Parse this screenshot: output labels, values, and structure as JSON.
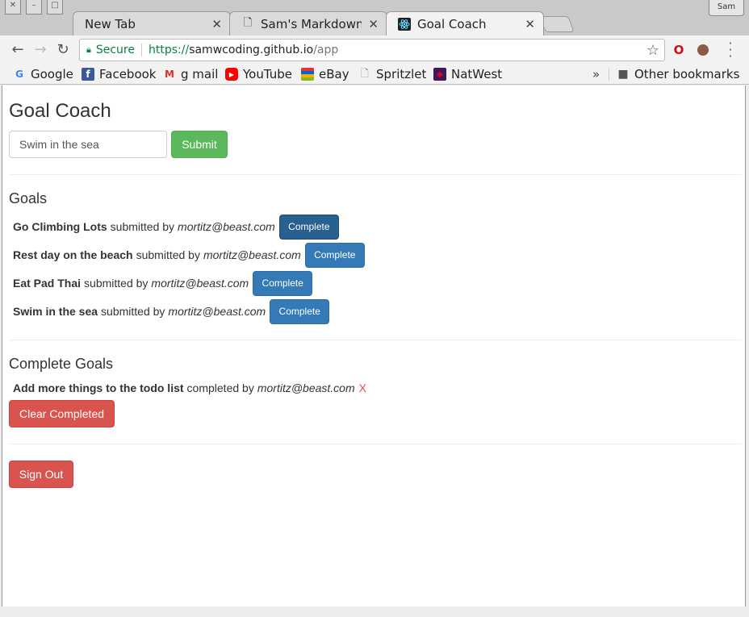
{
  "browser": {
    "profile_label": "Sam",
    "tabs": [
      {
        "title": "New Tab",
        "icon": "none",
        "active": false
      },
      {
        "title": "Sam's Markdown Pr",
        "icon": "page-icon",
        "active": false
      },
      {
        "title": "Goal Coach",
        "icon": "react-icon",
        "active": true
      }
    ],
    "tab_close": "✕",
    "omnibox": {
      "secure_label": "Secure",
      "url_scheme": "https://",
      "url_host": "samwcoding.github.io",
      "url_path": "/app"
    },
    "bookmarks": [
      {
        "label": "Google",
        "icon": "google-icon",
        "color": "#4285f4"
      },
      {
        "label": "Facebook",
        "icon": "facebook-icon",
        "color": "#3b5998"
      },
      {
        "label": "g mail",
        "icon": "gmail-icon",
        "color": "#d93025"
      },
      {
        "label": "YouTube",
        "icon": "youtube-icon",
        "color": "#ff0000"
      },
      {
        "label": "eBay",
        "icon": "ebay-icon",
        "color": "#e53238"
      },
      {
        "label": "Spritzlet",
        "icon": "page-icon",
        "color": "#777777"
      },
      {
        "label": "NatWest",
        "icon": "natwest-icon",
        "color": "#5a287d"
      }
    ],
    "bookmarks_overflow": "»",
    "other_bookmarks": "Other bookmarks"
  },
  "app": {
    "title": "Goal Coach",
    "input_value": "Swim in the sea",
    "submit_label": "Submit",
    "goals_heading": "Goals",
    "submitted_by": "submitted by",
    "complete_label": "Complete",
    "goals": [
      {
        "title": "Go Climbing Lots",
        "email": "mortitz@beast.com"
      },
      {
        "title": "Rest day on the beach",
        "email": "mortitz@beast.com"
      },
      {
        "title": "Eat Pad Thai",
        "email": "mortitz@beast.com"
      },
      {
        "title": "Swim in the sea",
        "email": "mortitz@beast.com"
      }
    ],
    "complete_heading": "Complete Goals",
    "completed_by": "completed by",
    "completed_goals": [
      {
        "title": "Add more things to the todo list",
        "email": "mortitz@beast.com",
        "remove": "X"
      }
    ],
    "clear_label": "Clear Completed",
    "signout_label": "Sign Out"
  },
  "colors": {
    "success": "#5cb85c",
    "primary": "#337ab7",
    "danger": "#d9534f",
    "secure_green": "#0b8043"
  }
}
